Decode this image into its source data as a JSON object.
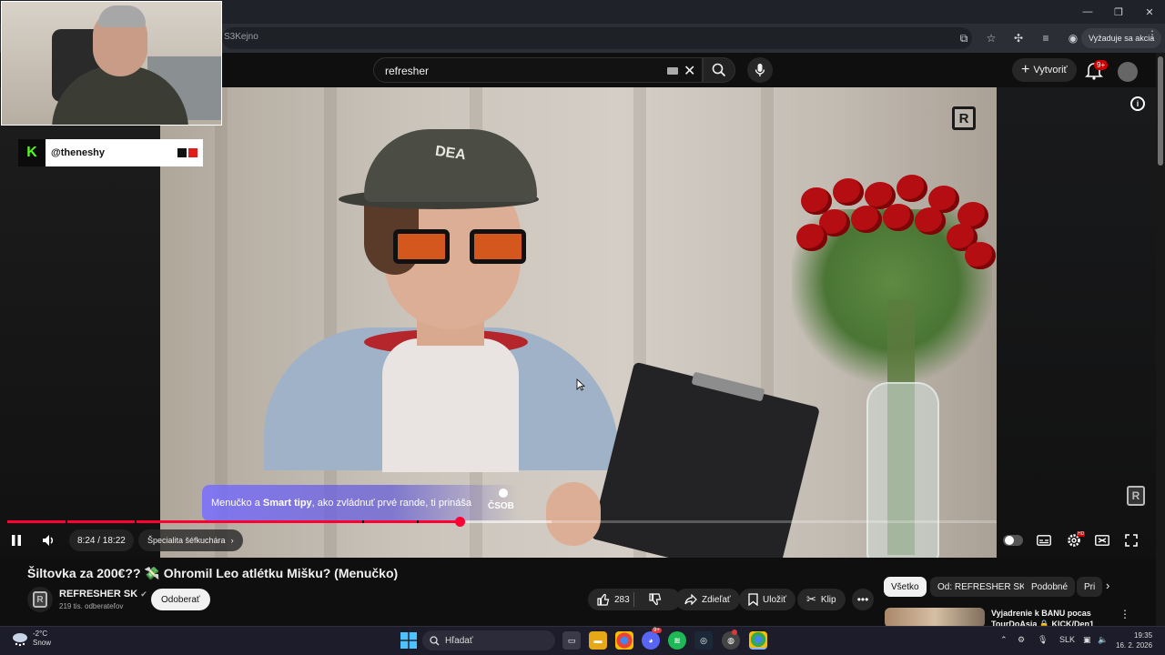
{
  "browser": {
    "url_text": "S3Kejno",
    "action_label": "Vyžaduje sa akcia"
  },
  "masthead": {
    "search_value": "refresher",
    "create_label": "Vytvoriť",
    "notification_badge": "9+"
  },
  "webcam_overlay": {
    "kick_logo": "K",
    "handle": "@theneshy"
  },
  "player": {
    "promo_text_prefix": "Menučko a ",
    "promo_text_bold": "Smart tipy",
    "promo_text_suffix": ", ako zvládnuť prvé rande, ti prináša",
    "sponsor_logo": "ČSOB",
    "channel_watermark": "R",
    "current_time": "8:24",
    "duration": "18:22",
    "time_display": "8:24 / 18:22",
    "chapter_label": "Špecialita šéfkuchára",
    "progress_fraction": 0.457,
    "buffered_fraction": 0.55,
    "settings_badge": "HD"
  },
  "video": {
    "title": "Šiltovka za 200€?? 💸 Ohromil Leo atlétku Mišku? (Menučko)",
    "channel_name": "REFRESHER SK",
    "channel_logo": "R",
    "subscribers": "219 tis. odberateľov",
    "subscribe_label": "Odoberať",
    "like_count": "283",
    "share_label": "Zdieľať",
    "save_label": "Uložiť",
    "clip_label": "Klip"
  },
  "sidebar": {
    "chips": [
      "Všetko",
      "Od: REFRESHER SK",
      "Podobné",
      "Pri"
    ],
    "recommendation_title": "Vyjadrenie k BANU pocas TourDoAsia 🔒 KICK/Den1"
  },
  "taskbar": {
    "weather_temp": "-2°C",
    "weather_desc": "Snow",
    "search_placeholder": "Hľadať",
    "discord_badge": "9+",
    "language": "SLK",
    "time": "19:35",
    "date": "16. 2. 2026"
  },
  "colors": {
    "youtube_red": "#ff0033",
    "kick_green": "#53fc18",
    "page_bg": "#0f0f0f"
  }
}
